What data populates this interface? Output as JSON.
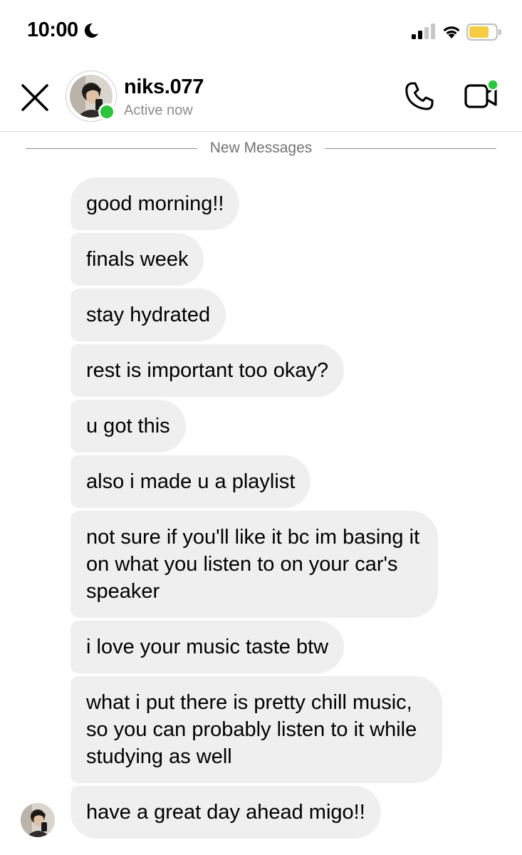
{
  "status_bar": {
    "time": "10:00",
    "moon_icon": "moon-icon",
    "signal_icon": "cellular-signal-icon",
    "wifi_icon": "wifi-icon",
    "battery_icon": "battery-icon",
    "battery_color": "#f5cc44"
  },
  "header": {
    "close_icon": "close-icon",
    "username": "niks.077",
    "status": "Active now",
    "online_color": "#2bc43d",
    "call_icon": "phone-icon",
    "video_icon": "video-call-icon"
  },
  "divider": {
    "label": "New Messages"
  },
  "messages": [
    {
      "text": "good morning!!"
    },
    {
      "text": "finals week"
    },
    {
      "text": "stay hydrated"
    },
    {
      "text": "rest is important too okay?"
    },
    {
      "text": "u got this"
    },
    {
      "text": "also i made u a playlist"
    },
    {
      "text": "not sure if you'll like it bc im basing it on what you listen to on your car's speaker"
    },
    {
      "text": "i love your music taste btw"
    },
    {
      "text": "what i put there is pretty chill music, so you can probably listen to it while studying as well"
    },
    {
      "text": "have a great day ahead migo!!"
    }
  ],
  "colors": {
    "bubble": "#efefef",
    "secondary_text": "#8e8e8e"
  }
}
